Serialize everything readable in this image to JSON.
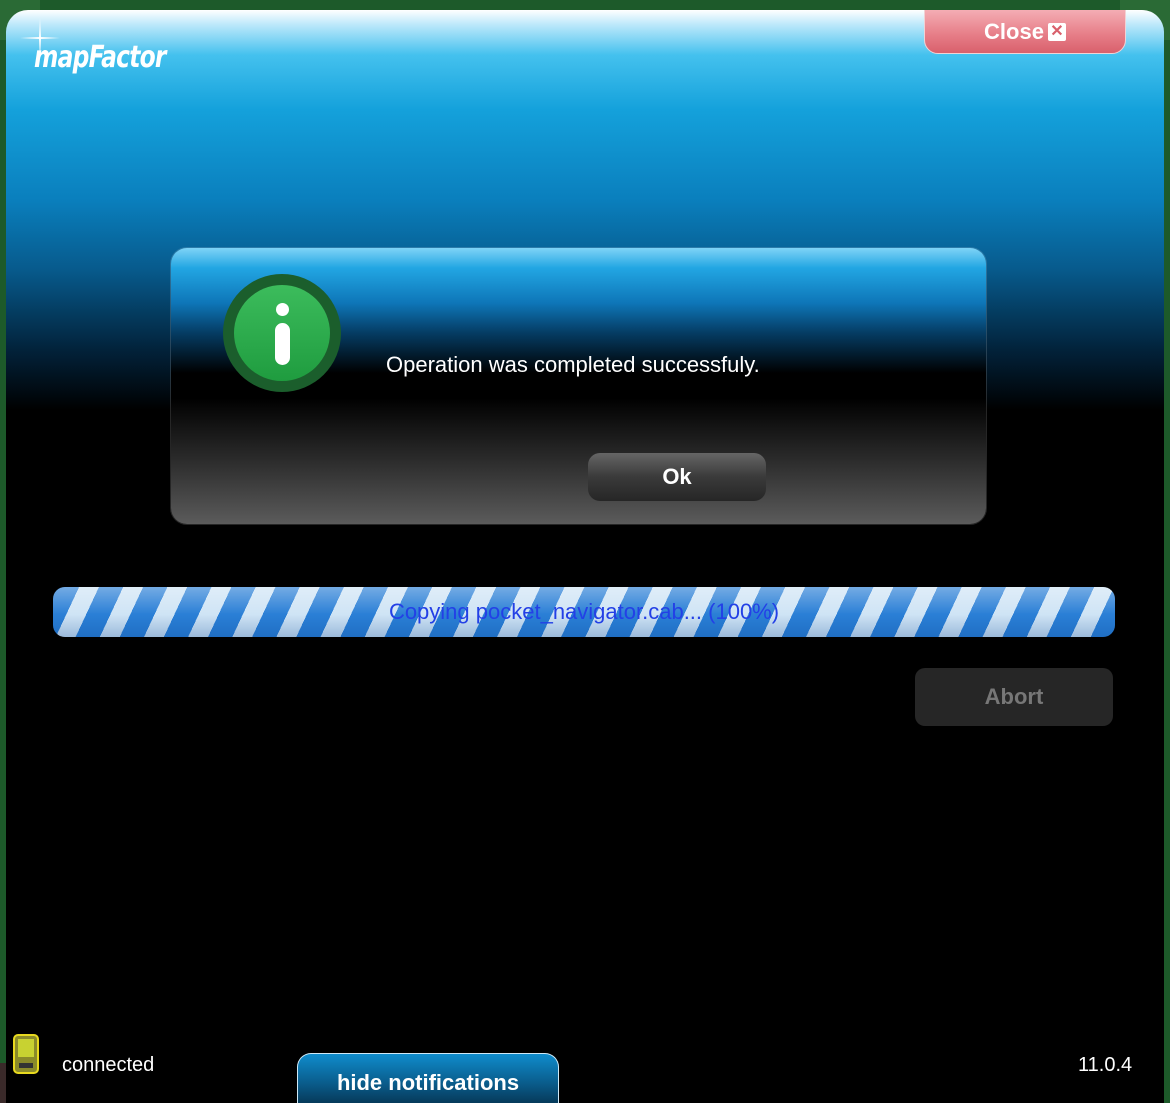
{
  "app": {
    "logo_text": "mapFactor"
  },
  "header": {
    "close_label": "Close",
    "close_icon": "close-x-icon"
  },
  "dialog": {
    "icon": "info-icon",
    "message": "Operation was completed successfuly.",
    "ok_label": "Ok"
  },
  "progress": {
    "label": "Copying pocket_navigator.cab... (100%)",
    "percent": 100
  },
  "actions": {
    "abort_label": "Abort"
  },
  "footer": {
    "device_icon": "pda-device-icon",
    "status": "connected",
    "hide_notifications_label": "hide notifications",
    "version": "11.0.4"
  },
  "colors": {
    "accent_blue": "#0a7fbd",
    "close_red": "#e77f89",
    "info_green": "#2fae4e",
    "progress_text": "#2340e6"
  }
}
